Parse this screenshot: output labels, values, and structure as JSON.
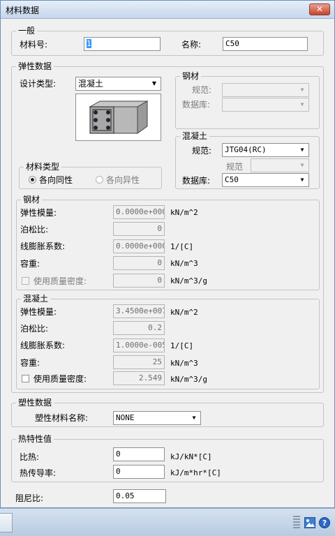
{
  "window": {
    "title": "材料数据",
    "close_label": "✕"
  },
  "general": {
    "legend": "一般",
    "material_no_label": "材料号:",
    "material_no_value": "1",
    "name_label": "名称:",
    "name_value": "C50"
  },
  "elastic": {
    "legend": "弹性数据",
    "design_type_label": "设计类型:",
    "design_type_value": "混凝土",
    "steel_box": {
      "legend": "钢材",
      "standard_label": "规范:",
      "standard_value": "",
      "database_label": "数据库:",
      "database_value": ""
    },
    "concrete_box": {
      "legend": "混凝土",
      "standard_label": "规范:",
      "standard_value": "JTG04(RC)",
      "sub_standard_label": "规范",
      "sub_standard_value": "",
      "database_label": "数据库:",
      "database_value": "C50"
    },
    "material_type": {
      "legend": "材料类型",
      "isotropic": "各向同性",
      "anisotropic": "各向异性",
      "selected": "isotropic"
    },
    "steel": {
      "legend": "钢材",
      "rows": [
        {
          "label": "弹性模量:",
          "value": "0.0000e+000",
          "unit": "kN/m^2"
        },
        {
          "label": "泊松比:",
          "value": "0",
          "unit": ""
        },
        {
          "label": "线膨胀系数:",
          "value": "0.0000e+000",
          "unit": "1/[C]"
        },
        {
          "label": "容重:",
          "value": "0",
          "unit": "kN/m^3"
        },
        {
          "label": "使用质量密度:",
          "value": "0",
          "unit": "kN/m^3/g"
        }
      ]
    },
    "concrete": {
      "legend": "混凝土",
      "rows": [
        {
          "label": "弹性模量:",
          "value": "3.4500e+007",
          "unit": "kN/m^2"
        },
        {
          "label": "泊松比:",
          "value": "0.2",
          "unit": ""
        },
        {
          "label": "线膨胀系数:",
          "value": "1.0000e-005",
          "unit": "1/[C]"
        },
        {
          "label": "容重:",
          "value": "25",
          "unit": "kN/m^3"
        },
        {
          "label": "使用质量密度:",
          "value": "2.549",
          "unit": "kN/m^3/g"
        }
      ]
    }
  },
  "plastic": {
    "legend": "塑性数据",
    "name_label": "塑性材料名称:",
    "name_value": "NONE"
  },
  "thermal": {
    "legend": "热特性值",
    "specific_heat_label": "比热:",
    "specific_heat_value": "0",
    "specific_heat_unit": "kJ/kN*[C]",
    "conductivity_label": "热传导率:",
    "conductivity_value": "0",
    "conductivity_unit": "kJ/m*hr*[C]"
  },
  "damping": {
    "label": "阻尼比:",
    "value": "0.05"
  },
  "colors": {
    "accent": "#3399ff",
    "window_bg": "#f0f0f0",
    "close_red": "#c6432a"
  }
}
